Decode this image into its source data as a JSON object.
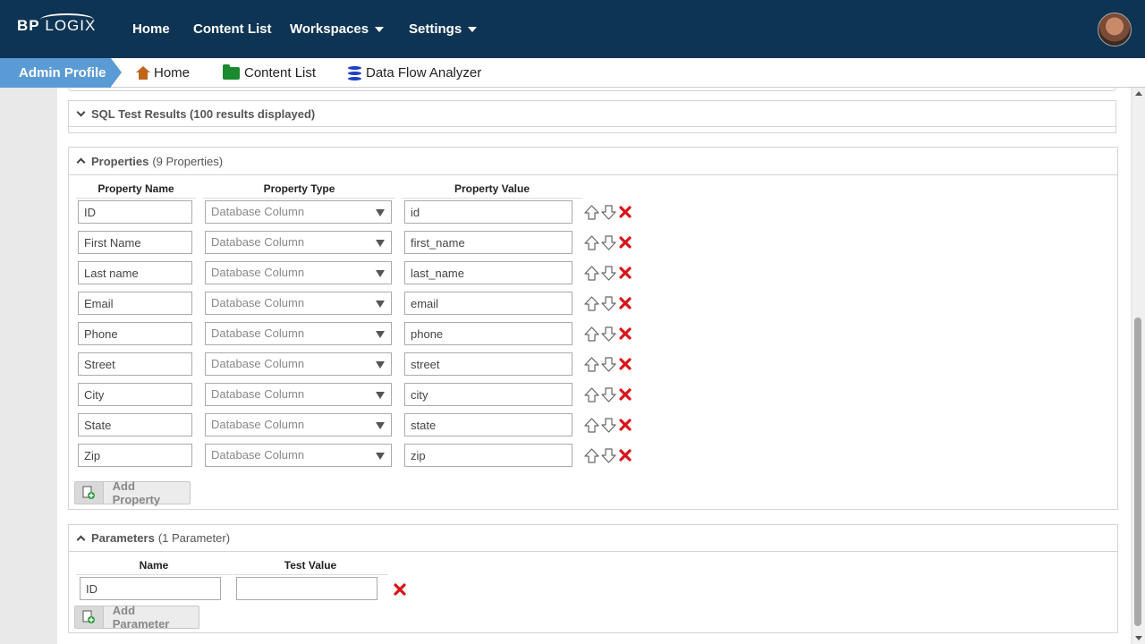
{
  "brand": {
    "logo_bp": "BP",
    "logo_rest": "LOGIX"
  },
  "topnav": {
    "home": "Home",
    "content_list": "Content List",
    "workspaces": "Workspaces",
    "settings": "Settings"
  },
  "breadcrumb": {
    "admin_profile": "Admin Profile",
    "home": "Home",
    "content_list": "Content List",
    "data_flow_analyzer": "Data Flow Analyzer"
  },
  "sql_test_results": {
    "title": "SQL Test Results (100 results displayed)"
  },
  "properties": {
    "title": "Properties",
    "count": "(9 Properties)",
    "columns": {
      "name": "Property Name",
      "type": "Property Type",
      "value": "Property Value"
    },
    "rows": [
      {
        "name": "ID",
        "type": "Database Column",
        "value": "id"
      },
      {
        "name": "First Name",
        "type": "Database Column",
        "value": "first_name"
      },
      {
        "name": "Last name",
        "type": "Database Column",
        "value": "last_name"
      },
      {
        "name": "Email",
        "type": "Database Column",
        "value": "email"
      },
      {
        "name": "Phone",
        "type": "Database Column",
        "value": "phone"
      },
      {
        "name": "Street",
        "type": "Database Column",
        "value": "street"
      },
      {
        "name": "City",
        "type": "Database Column",
        "value": "city"
      },
      {
        "name": "State",
        "type": "Database Column",
        "value": "state"
      },
      {
        "name": "Zip",
        "type": "Database Column",
        "value": "zip"
      }
    ],
    "add_button": "Add Property"
  },
  "parameters": {
    "title": "Parameters",
    "count": "(1 Parameter)",
    "columns": {
      "name": "Name",
      "test_value": "Test Value"
    },
    "rows": [
      {
        "name": "ID",
        "test_value": ""
      }
    ],
    "add_button": "Add Parameter"
  },
  "colors": {
    "nav_bg": "#0e3454",
    "crumb_active": "#5b9bd5",
    "delete_red": "#d9141b"
  }
}
